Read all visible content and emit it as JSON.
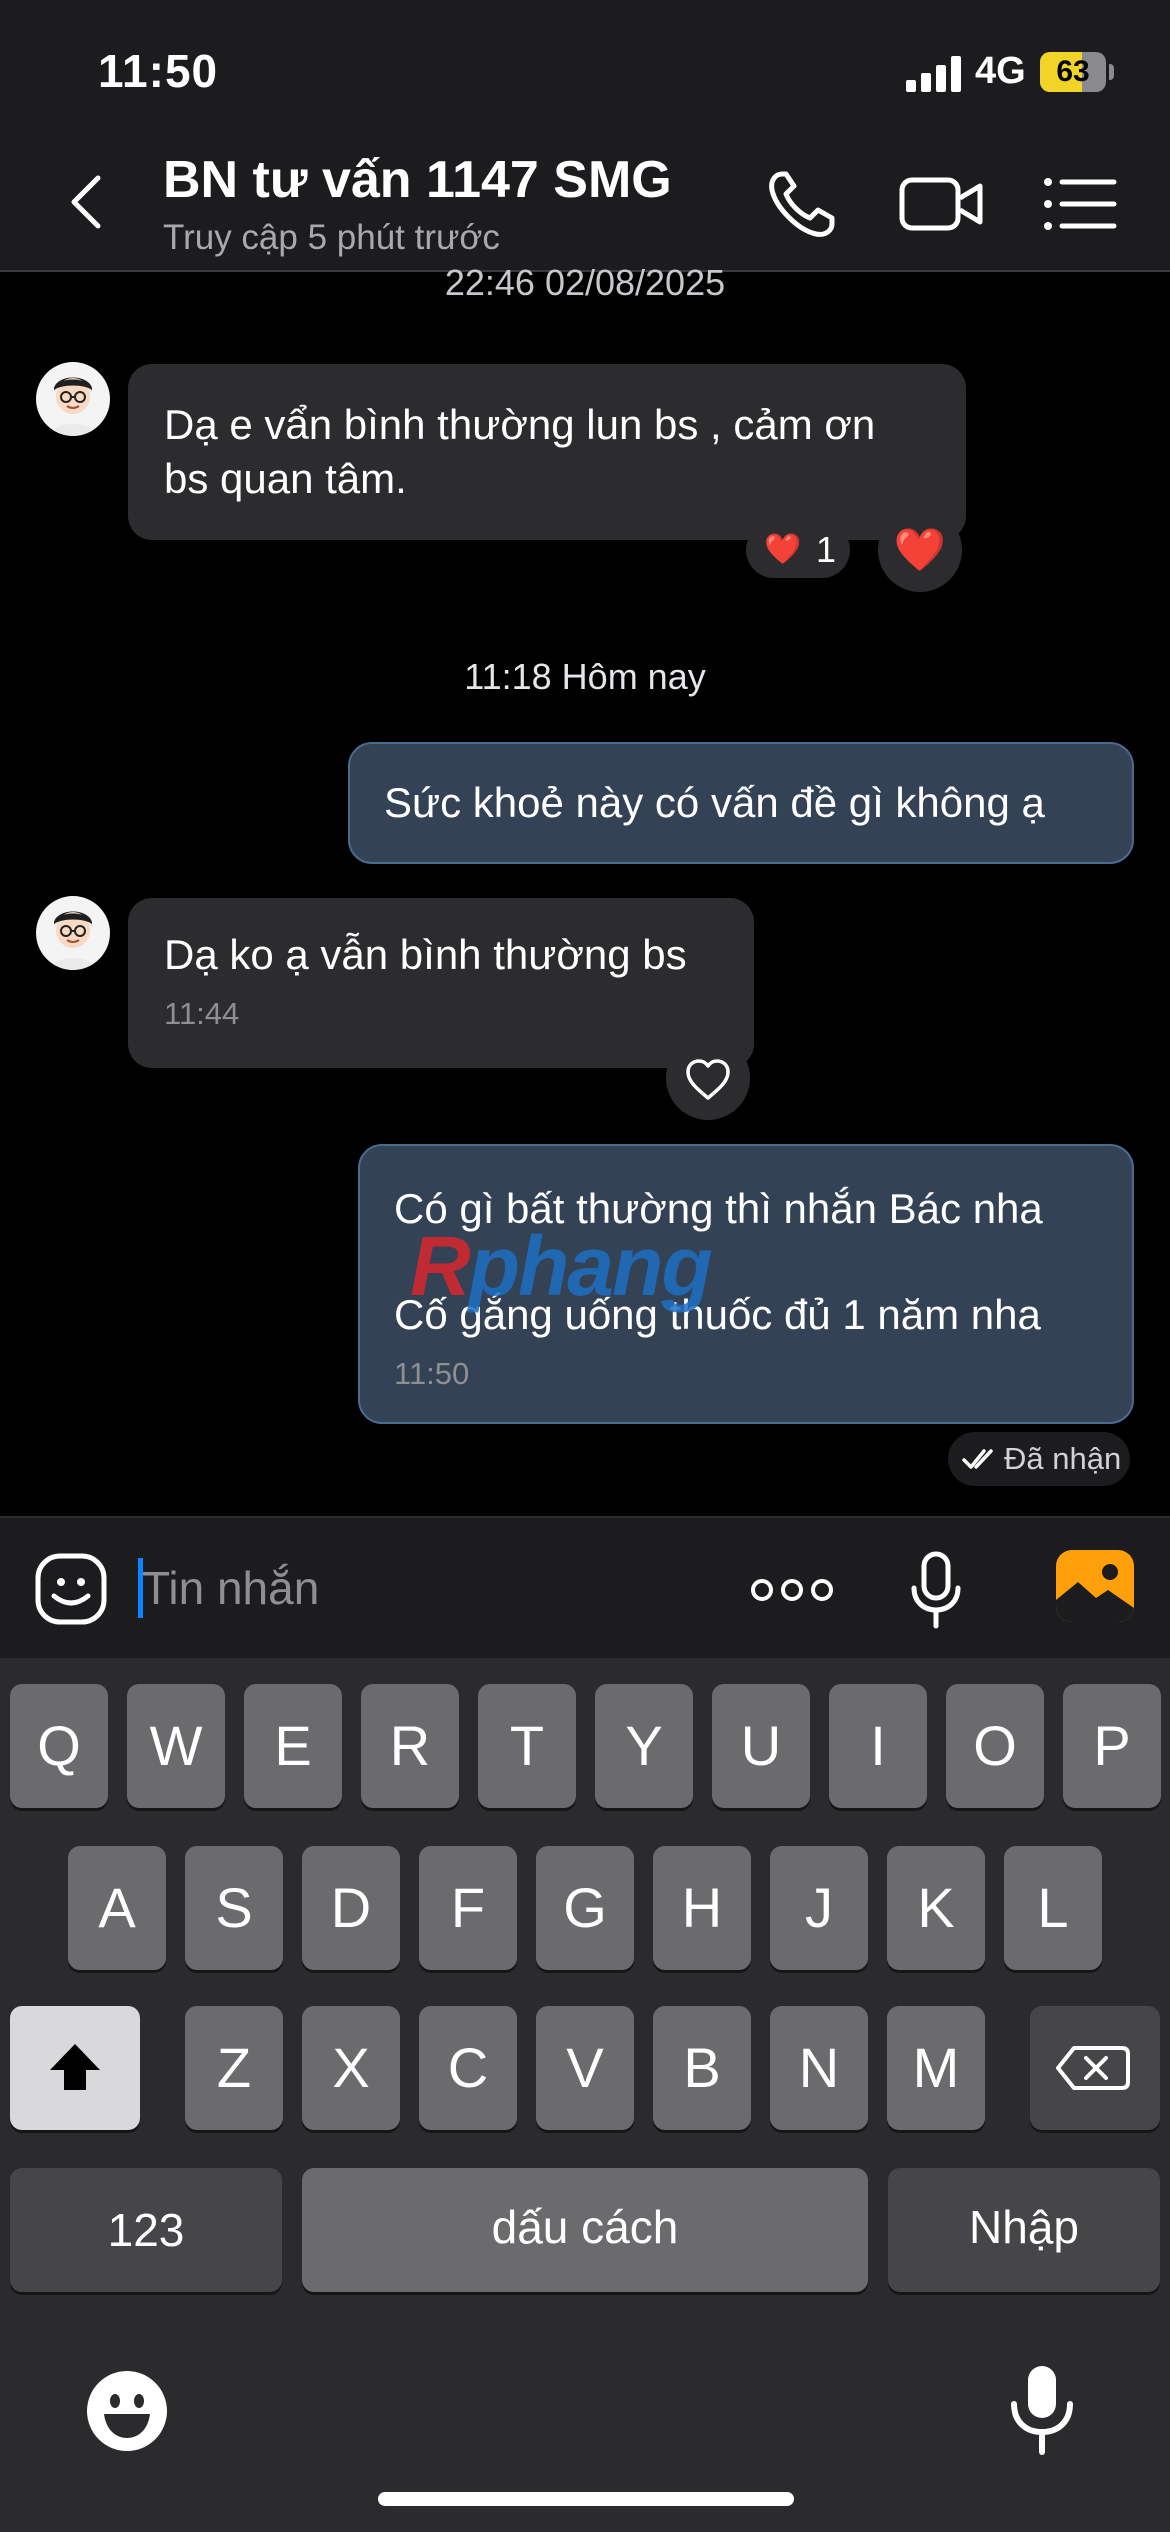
{
  "status_bar": {
    "time": "11:50",
    "network": "4G",
    "battery_level": "63",
    "battery_percent": 63,
    "battery_color": "#f2d426",
    "signal_icon": "signal-bars-icon"
  },
  "header": {
    "title": "BN tư vấn 1147 SMG",
    "subtitle": "Truy cập 5 phút trước",
    "icons": [
      "back-chevron-icon",
      "phone-icon",
      "video-camera-icon",
      "list-menu-icon"
    ]
  },
  "conversation": {
    "date_top": "22:46 02/08/2025",
    "date_today": "11:18 Hôm nay",
    "messages": [
      {
        "direction": "incoming",
        "lines": [
          "Dạ e vẩn bình thường lun bs , cảm ơn",
          "bs quan tâm."
        ],
        "reaction_emoji": "❤️",
        "reaction_count": "1",
        "reaction_button": "❤️"
      },
      {
        "direction": "outgoing",
        "lines": [
          "Sức khoẻ này có vấn đề gì không ạ"
        ]
      },
      {
        "direction": "incoming",
        "lines": [
          "Dạ ko ạ vẫn bình thường bs"
        ],
        "time": "11:44",
        "reaction_button_icon": "heart-outline-icon"
      },
      {
        "direction": "outgoing",
        "lines": [
          "Có gì bất thường thì nhắn Bác nha",
          "Cố gắng uống thuốc đủ 1 năm nha"
        ],
        "time": "11:50"
      }
    ],
    "delivery_status": "Đã nhận",
    "watermark": {
      "part1": "R",
      "part2": "phang"
    }
  },
  "composer": {
    "placeholder": "Tin nhắn",
    "value": "",
    "accent_color": "#0a84ff",
    "photo_button_color": "#ff9f0a"
  },
  "keyboard": {
    "row1": [
      "Q",
      "W",
      "E",
      "R",
      "T",
      "Y",
      "U",
      "I",
      "O",
      "P"
    ],
    "row2": [
      "A",
      "S",
      "D",
      "F",
      "G",
      "H",
      "J",
      "K",
      "L"
    ],
    "row3": [
      "Z",
      "X",
      "C",
      "V",
      "B",
      "N",
      "M"
    ],
    "numbers_label": "123",
    "space_label": "dấu cách",
    "return_label": "Nhập"
  }
}
